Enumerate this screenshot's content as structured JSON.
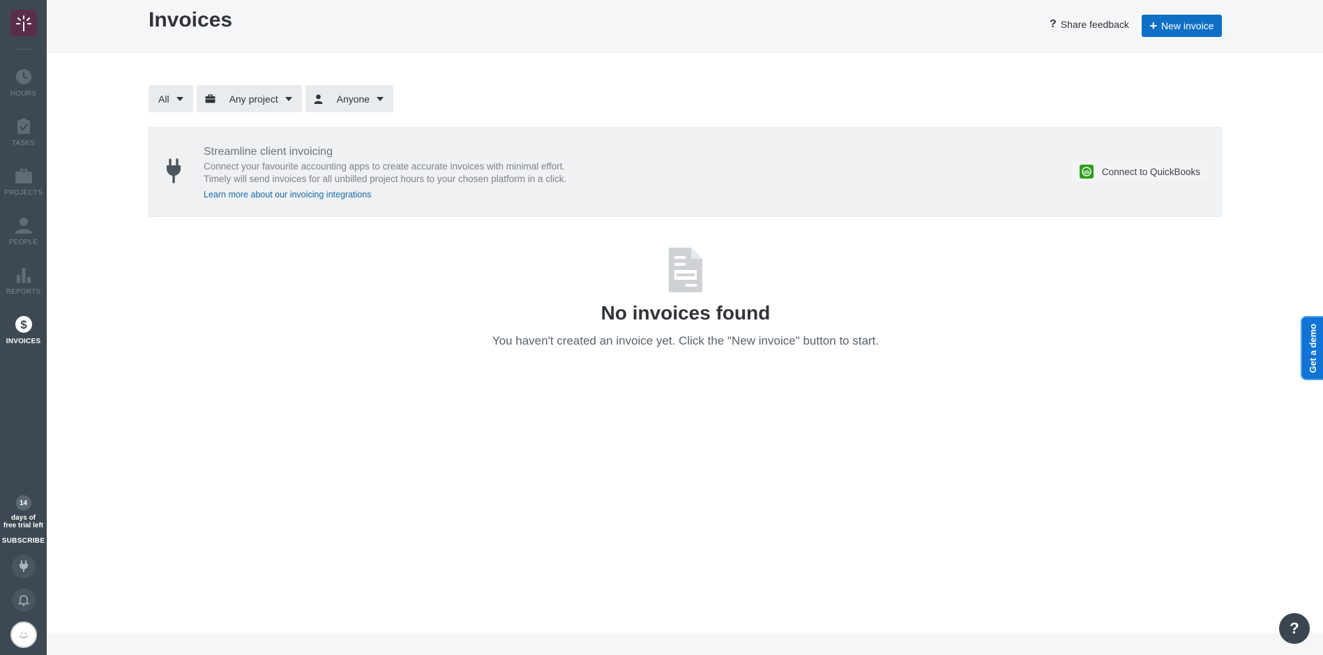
{
  "sidebar": {
    "items": [
      {
        "label": "HOURS",
        "icon": "clock-icon"
      },
      {
        "label": "TASKS",
        "icon": "task-clipboard-icon"
      },
      {
        "label": "PROJECTS",
        "icon": "briefcase-icon"
      },
      {
        "label": "PEOPLE",
        "icon": "person-icon"
      },
      {
        "label": "REPORTS",
        "icon": "bar-chart-icon"
      },
      {
        "label": "INVOICES",
        "icon": "dollar-icon",
        "active": true
      }
    ],
    "trial_days": "14",
    "trial_line1": "days of",
    "trial_line2": "free trial left",
    "subscribe_label": "SUBSCRIBE"
  },
  "header": {
    "title": "Invoices",
    "share_feedback_icon": "?",
    "share_feedback_label": "Share feedback",
    "new_invoice_icon": "+",
    "new_invoice_label": "New invoice"
  },
  "filters": {
    "status": "All",
    "project": "Any project",
    "person": "Anyone"
  },
  "banner": {
    "title": "Streamline client invoicing",
    "desc_line1": "Connect your favourite accounting apps to create accurate invoices with minimal effort.",
    "desc_line2": "Timely will send invoices for all unbilled project hours to your chosen platform in a click.",
    "link": "Learn more about our invoicing integrations",
    "connect_label": "Connect to QuickBooks",
    "qb_logo_text": "qb"
  },
  "empty_state": {
    "title": "No invoices found",
    "subtitle": "You haven't created an invoice yet. Click the \"New invoice\" button to start."
  },
  "demo_tab": "Get a demo",
  "help_label": "?",
  "colors": {
    "sidebar_bg": "#3d4852",
    "primary": "#0f6fc6",
    "quickbooks_green": "#2ca01c"
  }
}
